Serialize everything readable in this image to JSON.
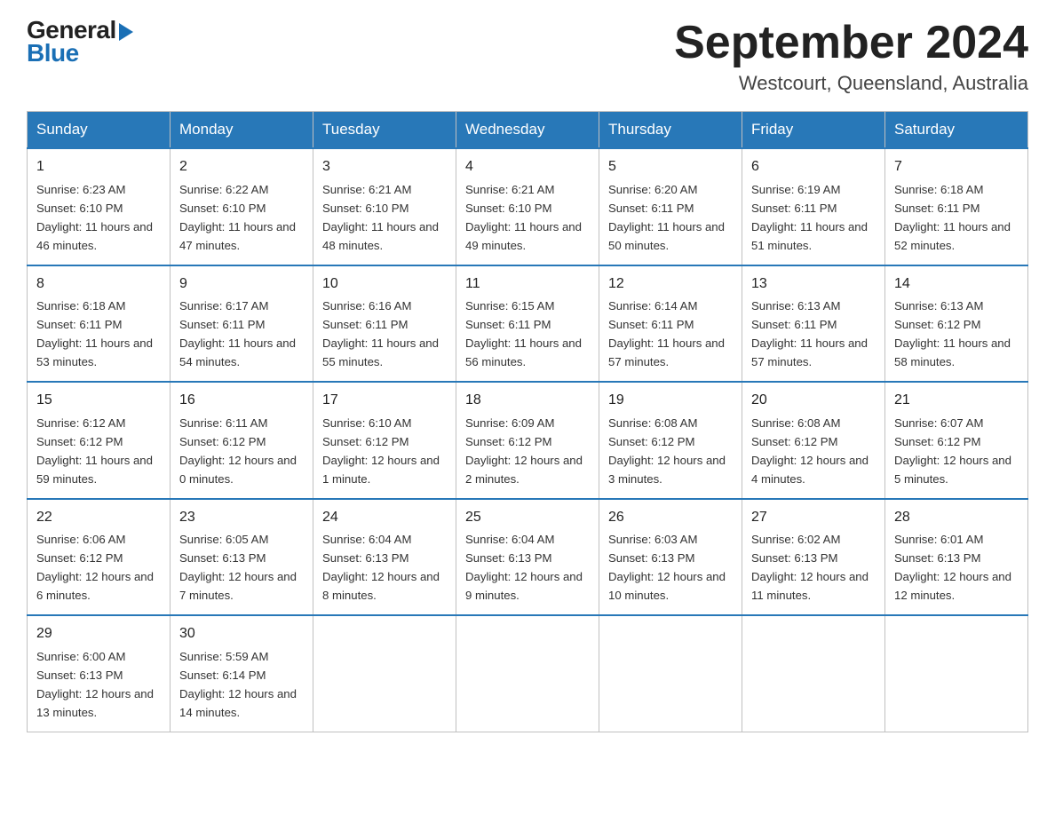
{
  "header": {
    "title": "September 2024",
    "subtitle": "Westcourt, Queensland, Australia"
  },
  "days_of_week": [
    "Sunday",
    "Monday",
    "Tuesday",
    "Wednesday",
    "Thursday",
    "Friday",
    "Saturday"
  ],
  "weeks": [
    [
      {
        "day": "1",
        "sunrise": "6:23 AM",
        "sunset": "6:10 PM",
        "daylight": "11 hours and 46 minutes."
      },
      {
        "day": "2",
        "sunrise": "6:22 AM",
        "sunset": "6:10 PM",
        "daylight": "11 hours and 47 minutes."
      },
      {
        "day": "3",
        "sunrise": "6:21 AM",
        "sunset": "6:10 PM",
        "daylight": "11 hours and 48 minutes."
      },
      {
        "day": "4",
        "sunrise": "6:21 AM",
        "sunset": "6:10 PM",
        "daylight": "11 hours and 49 minutes."
      },
      {
        "day": "5",
        "sunrise": "6:20 AM",
        "sunset": "6:11 PM",
        "daylight": "11 hours and 50 minutes."
      },
      {
        "day": "6",
        "sunrise": "6:19 AM",
        "sunset": "6:11 PM",
        "daylight": "11 hours and 51 minutes."
      },
      {
        "day": "7",
        "sunrise": "6:18 AM",
        "sunset": "6:11 PM",
        "daylight": "11 hours and 52 minutes."
      }
    ],
    [
      {
        "day": "8",
        "sunrise": "6:18 AM",
        "sunset": "6:11 PM",
        "daylight": "11 hours and 53 minutes."
      },
      {
        "day": "9",
        "sunrise": "6:17 AM",
        "sunset": "6:11 PM",
        "daylight": "11 hours and 54 minutes."
      },
      {
        "day": "10",
        "sunrise": "6:16 AM",
        "sunset": "6:11 PM",
        "daylight": "11 hours and 55 minutes."
      },
      {
        "day": "11",
        "sunrise": "6:15 AM",
        "sunset": "6:11 PM",
        "daylight": "11 hours and 56 minutes."
      },
      {
        "day": "12",
        "sunrise": "6:14 AM",
        "sunset": "6:11 PM",
        "daylight": "11 hours and 57 minutes."
      },
      {
        "day": "13",
        "sunrise": "6:13 AM",
        "sunset": "6:11 PM",
        "daylight": "11 hours and 57 minutes."
      },
      {
        "day": "14",
        "sunrise": "6:13 AM",
        "sunset": "6:12 PM",
        "daylight": "11 hours and 58 minutes."
      }
    ],
    [
      {
        "day": "15",
        "sunrise": "6:12 AM",
        "sunset": "6:12 PM",
        "daylight": "11 hours and 59 minutes."
      },
      {
        "day": "16",
        "sunrise": "6:11 AM",
        "sunset": "6:12 PM",
        "daylight": "12 hours and 0 minutes."
      },
      {
        "day": "17",
        "sunrise": "6:10 AM",
        "sunset": "6:12 PM",
        "daylight": "12 hours and 1 minute."
      },
      {
        "day": "18",
        "sunrise": "6:09 AM",
        "sunset": "6:12 PM",
        "daylight": "12 hours and 2 minutes."
      },
      {
        "day": "19",
        "sunrise": "6:08 AM",
        "sunset": "6:12 PM",
        "daylight": "12 hours and 3 minutes."
      },
      {
        "day": "20",
        "sunrise": "6:08 AM",
        "sunset": "6:12 PM",
        "daylight": "12 hours and 4 minutes."
      },
      {
        "day": "21",
        "sunrise": "6:07 AM",
        "sunset": "6:12 PM",
        "daylight": "12 hours and 5 minutes."
      }
    ],
    [
      {
        "day": "22",
        "sunrise": "6:06 AM",
        "sunset": "6:12 PM",
        "daylight": "12 hours and 6 minutes."
      },
      {
        "day": "23",
        "sunrise": "6:05 AM",
        "sunset": "6:13 PM",
        "daylight": "12 hours and 7 minutes."
      },
      {
        "day": "24",
        "sunrise": "6:04 AM",
        "sunset": "6:13 PM",
        "daylight": "12 hours and 8 minutes."
      },
      {
        "day": "25",
        "sunrise": "6:04 AM",
        "sunset": "6:13 PM",
        "daylight": "12 hours and 9 minutes."
      },
      {
        "day": "26",
        "sunrise": "6:03 AM",
        "sunset": "6:13 PM",
        "daylight": "12 hours and 10 minutes."
      },
      {
        "day": "27",
        "sunrise": "6:02 AM",
        "sunset": "6:13 PM",
        "daylight": "12 hours and 11 minutes."
      },
      {
        "day": "28",
        "sunrise": "6:01 AM",
        "sunset": "6:13 PM",
        "daylight": "12 hours and 12 minutes."
      }
    ],
    [
      {
        "day": "29",
        "sunrise": "6:00 AM",
        "sunset": "6:13 PM",
        "daylight": "12 hours and 13 minutes."
      },
      {
        "day": "30",
        "sunrise": "5:59 AM",
        "sunset": "6:14 PM",
        "daylight": "12 hours and 14 minutes."
      },
      null,
      null,
      null,
      null,
      null
    ]
  ],
  "labels": {
    "sunrise": "Sunrise:",
    "sunset": "Sunset:",
    "daylight": "Daylight:"
  }
}
